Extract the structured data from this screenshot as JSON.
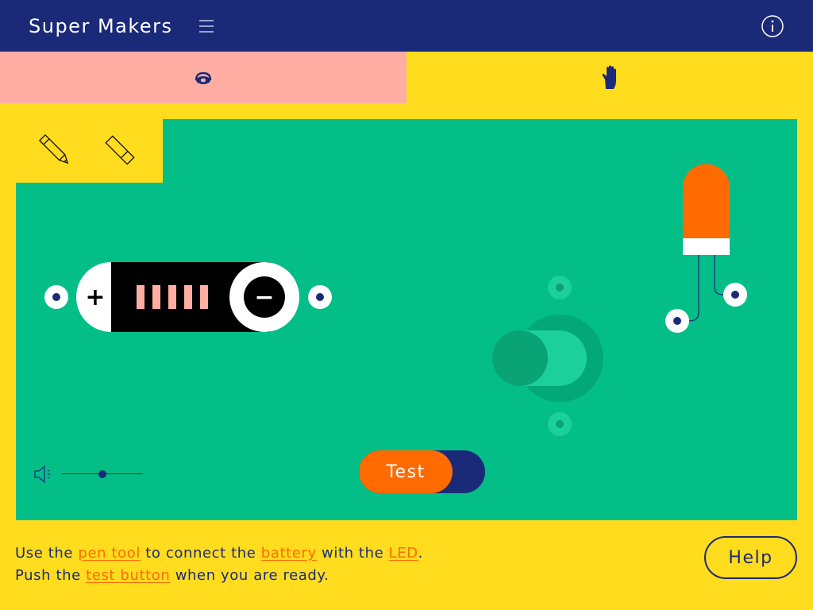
{
  "app": {
    "title": "Super Makers"
  },
  "header": {
    "menu_icon": "hamburger-menu-icon",
    "info_icon": "info-icon"
  },
  "tabs": [
    {
      "icon": "eye-icon",
      "selected": true
    },
    {
      "icon": "hand-icon",
      "selected": false
    }
  ],
  "tools": [
    {
      "icon": "pencil-icon"
    },
    {
      "icon": "eraser-icon"
    }
  ],
  "components": {
    "battery": {
      "plus": "+",
      "minus": "−",
      "charge_bars": 5
    },
    "switch": {
      "state": "off"
    },
    "led": {
      "color": "orange"
    }
  },
  "volume": {
    "icon": "speaker-icon",
    "level": 0.5
  },
  "test_toggle": {
    "label": "Test"
  },
  "instructions": {
    "line1_part1": "Use the ",
    "pen_tool_link": "pen tool",
    "line1_part2": " to connect the ",
    "battery_link": "battery",
    "line1_part3": " with the ",
    "led_link": "LED",
    "line1_part4": ".",
    "line2_part1": "Push the ",
    "test_button_link": "test button",
    "line2_part2": " when you are ready."
  },
  "help_button": {
    "label": "Help"
  },
  "colors": {
    "navy": "#1B2A78",
    "yellow": "#FFDC1E",
    "pink": "#FFADA3",
    "green": "#04BE87",
    "orange": "#FF6B00"
  }
}
